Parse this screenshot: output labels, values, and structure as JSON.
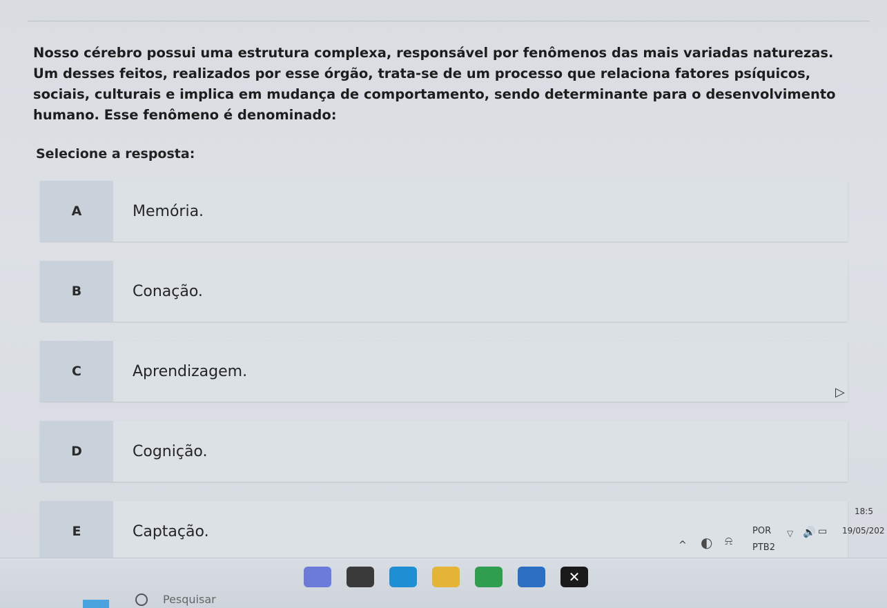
{
  "question": {
    "text": "Nosso cérebro possui uma estrutura complexa, responsável por fenômenos das mais variadas naturezas. Um desses feitos, realizados por esse órgão, trata-se de um processo que relaciona fatores psíquicos, sociais, culturais e implica em mudança de comportamento, sendo determinante para o desenvolvimento humano. Esse fenômeno é denominado:"
  },
  "prompt": "Selecione a resposta:",
  "options": [
    {
      "letter": "A",
      "text": "Memória."
    },
    {
      "letter": "B",
      "text": "Conação."
    },
    {
      "letter": "C",
      "text": "Aprendizagem."
    },
    {
      "letter": "D",
      "text": "Cognição."
    },
    {
      "letter": "E",
      "text": "Captação."
    }
  ],
  "taskbar": {
    "search_placeholder": "Pesquisar",
    "icons": [
      "file-explorer-icon",
      "edge-icon",
      "folder-icon",
      "chrome-icon",
      "store-icon",
      "xbox-icon"
    ],
    "colors": {
      "edge": "#1f8fd4",
      "folder": "#e3b436",
      "chrome": "#2f9e4f",
      "store": "#2b6fc2",
      "xbox": "#1a1a1a"
    }
  },
  "tray": {
    "chevron": "^",
    "language": "POR",
    "keyboard": "PTB2",
    "time": "18:5",
    "date": "19/05/202"
  }
}
